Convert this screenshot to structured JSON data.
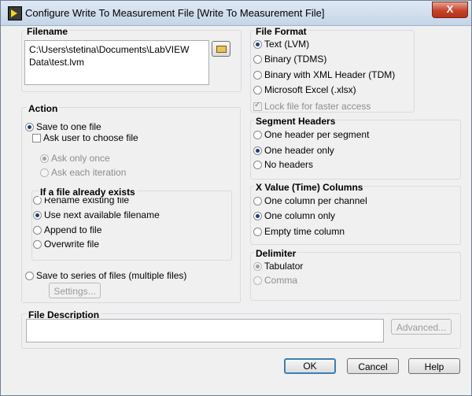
{
  "window": {
    "title": "Configure Write To Measurement File [Write To Measurement File]",
    "close_label": "X"
  },
  "filename": {
    "title": "Filename",
    "path_line1": "C:\\Users\\stetina\\Documents\\LabVIEW",
    "path_line2": "Data\\test.lvm"
  },
  "file_format": {
    "title": "File Format",
    "options": [
      "Text (LVM)",
      "Binary (TDMS)",
      "Binary with XML Header (TDM)",
      "Microsoft Excel (.xlsx)"
    ],
    "selected": "Text (LVM)",
    "lock_label": "Lock file for faster access"
  },
  "action": {
    "title": "Action",
    "save_one": "Save to one file",
    "ask_user": "Ask user to choose file",
    "ask_once": "Ask only once",
    "ask_each": "Ask each iteration",
    "exists_title": "If a file already exists",
    "exists_options": [
      "Rename existing file",
      "Use next available filename",
      "Append to file",
      "Overwrite file"
    ],
    "save_series": "Save to series of files (multiple files)",
    "settings_label": "Settings..."
  },
  "segment_headers": {
    "title": "Segment Headers",
    "options": [
      "One header per segment",
      "One header only",
      "No headers"
    ]
  },
  "x_value": {
    "title": "X Value (Time) Columns",
    "options": [
      "One column per channel",
      "One column only",
      "Empty time column"
    ]
  },
  "delimiter": {
    "title": "Delimiter",
    "options": [
      "Tabulator",
      "Comma"
    ]
  },
  "file_description": {
    "title": "File Description",
    "value": "",
    "advanced_label": "Advanced..."
  },
  "buttons": {
    "ok": "OK",
    "cancel": "Cancel",
    "help": "Help"
  }
}
